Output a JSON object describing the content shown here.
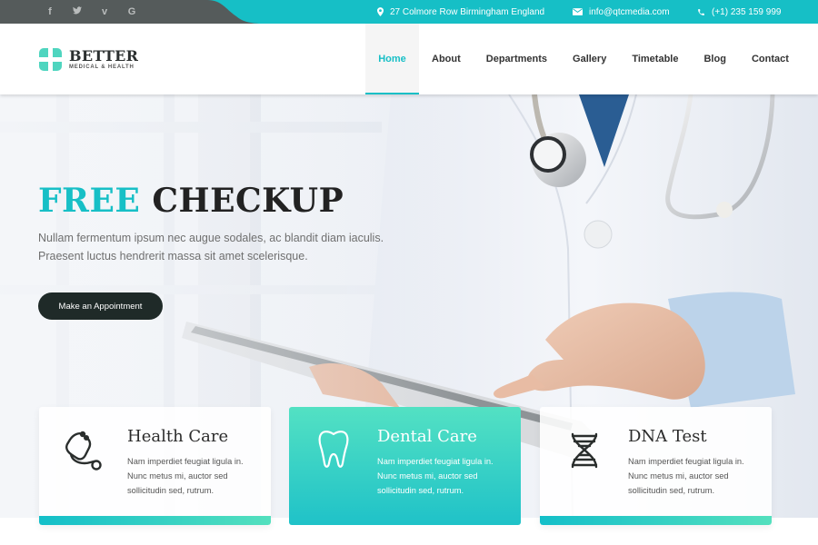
{
  "topbar": {
    "social": [
      {
        "icon": "facebook-icon",
        "glyph": "f"
      },
      {
        "icon": "twitter-icon",
        "glyph": "🐦︎"
      },
      {
        "icon": "vimeo-icon",
        "glyph": "v"
      },
      {
        "icon": "google-icon",
        "glyph": "G"
      }
    ],
    "address": "27 Colmore Row Birmingham England",
    "email": "info@qtcmedia.com",
    "phone": "(+1) 235 159 999",
    "colors": {
      "accent": "#16bfc6",
      "dark": "#555b5b"
    }
  },
  "header": {
    "logo": {
      "brand": "BETTER",
      "tagline": "MEDICAL & HEALTH",
      "color": "#4fd5bf"
    },
    "nav": [
      {
        "label": "Home",
        "active": true
      },
      {
        "label": "About",
        "active": false
      },
      {
        "label": "Departments",
        "active": false
      },
      {
        "label": "Gallery",
        "active": false
      },
      {
        "label": "Timetable",
        "active": false
      },
      {
        "label": "Blog",
        "active": false
      },
      {
        "label": "Contact",
        "active": false
      }
    ]
  },
  "hero": {
    "title_accent": "FREE",
    "title_rest": "CHECKUP",
    "subtitle_line1": "Nullam fermentum ipsum nec augue sodales, ac blandit diam iaculis.",
    "subtitle_line2": "Praesent luctus hendrerit massa sit amet scelerisque.",
    "cta_label": "Make an Appointment",
    "image": "doctor-with-stethoscope-holding-tablet"
  },
  "features": [
    {
      "icon": "stethoscope-icon",
      "title": "Health Care",
      "text": "Nam imperdiet feugiat ligula in. Nunc metus mi, auctor sed sollicitudin sed, rutrum."
    },
    {
      "icon": "tooth-icon",
      "title": "Dental Care",
      "text": "Nam imperdiet feugiat ligula in. Nunc metus mi, auctor sed sollicitudin sed, rutrum."
    },
    {
      "icon": "dna-icon",
      "title": "DNA Test",
      "text": "Nam imperdiet feugiat ligula in. Nunc metus mi, auctor sed sollicitudin sed, rutrum."
    }
  ]
}
